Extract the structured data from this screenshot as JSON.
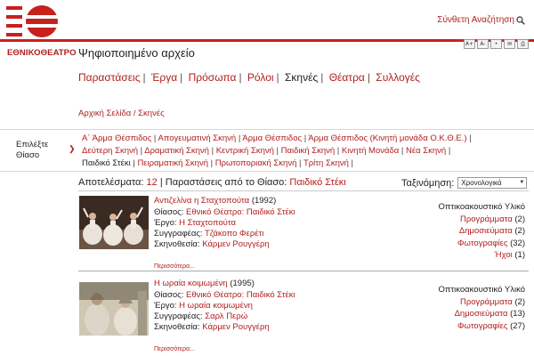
{
  "brand": {
    "logo_text": "ΕΘΝΙΚΟΘΕΑΤΡΟ",
    "accent": "#c8201e"
  },
  "header": {
    "advanced_search": "Σύνθετη Αναζήτηση",
    "page_title": "Ψηφιοποιημένο αρχείο",
    "tools": [
      "A+",
      "A-",
      "•",
      "✉",
      "⎙"
    ]
  },
  "mainnav": [
    "Παραστάσεις",
    "Έργα",
    "Πρόσωπα",
    "Ρόλοι",
    "Σκηνές",
    "Θέατρα",
    "Συλλογές"
  ],
  "breadcrumb": "Αρχική Σελίδα / Σκηνές",
  "filter": {
    "label_line1": "Επιλέξτε",
    "label_line2": "Θίασο",
    "lines": [
      [
        "Α΄ Άρμα Θέσπιδος",
        "Απογευματινή Σκηνή",
        "Άρμα Θέσπιδος",
        "Άρμα Θέσπιδος (Κινητή μονάδα Ο.Κ.Θ.Ε.)"
      ],
      [
        "Δεύτερη Σκηνή",
        "Δραματική Σκηνή",
        "Κεντρική Σκηνή",
        "Παιδική Σκηνή",
        "Κινητή Μονάδα",
        "Νέα Σκηνή"
      ],
      [
        "Παιδικό Στέκι",
        "Πειραματική Σκηνή",
        "Πρωτοποριακή Σκηνή",
        "Τρίτη Σκηνή"
      ]
    ]
  },
  "results": {
    "label": "Αποτελέσματα:",
    "count": "12",
    "mid": "| Παραστάσεις από το Θίασο:",
    "troupe": "Παιδικό Στέκι"
  },
  "sort": {
    "label": "Ταξινόμηση:",
    "value": "Χρονολογικά"
  },
  "items": [
    {
      "title": "Αντιζελίνα η Σταχτοπούτα",
      "year": "(1992)",
      "rows": [
        {
          "k": "Θίασος:",
          "v": "Εθνικό Θέατρο: Παιδικό Στέκι"
        },
        {
          "k": "Έργο:",
          "v": "Η Σταχτοπούτα"
        },
        {
          "k": "Συγγραφέας:",
          "v": "Τζάκοπο Φερέτι"
        },
        {
          "k": "Σκηνοθεσία:",
          "v": "Κάρμεν Ρουγγέρη"
        }
      ],
      "more": "Περισσότερα...",
      "av_title": "Οπτικοακουστικό Υλικό",
      "av": [
        {
          "k": "Προγράμματα",
          "n": "(2)"
        },
        {
          "k": "Δημοσιεύματα",
          "n": "(2)"
        },
        {
          "k": "Φωτογραφίες",
          "n": "(32)"
        },
        {
          "k": "Ήχοι",
          "n": "(1)"
        }
      ]
    },
    {
      "title": "Η ωραία κοιμωμένη",
      "year": "(1995)",
      "rows": [
        {
          "k": "Θίασος:",
          "v": "Εθνικό Θέατρο: Παιδικό Στέκι"
        },
        {
          "k": "Έργο:",
          "v": "Η ωραία κοιμωμένη"
        },
        {
          "k": "Συγγραφέας:",
          "v": "Σαρλ Περώ"
        },
        {
          "k": "Σκηνοθεσία:",
          "v": "Κάρμεν Ρουγγέρη"
        }
      ],
      "more": "Περισσότερα...",
      "av_title": "Οπτικοακουστικό Υλικό",
      "av": [
        {
          "k": "Προγράμματα",
          "n": "(2)"
        },
        {
          "k": "Δημοσιεύματα",
          "n": "(13)"
        },
        {
          "k": "Φωτογραφίες",
          "n": "(27)"
        }
      ]
    }
  ]
}
